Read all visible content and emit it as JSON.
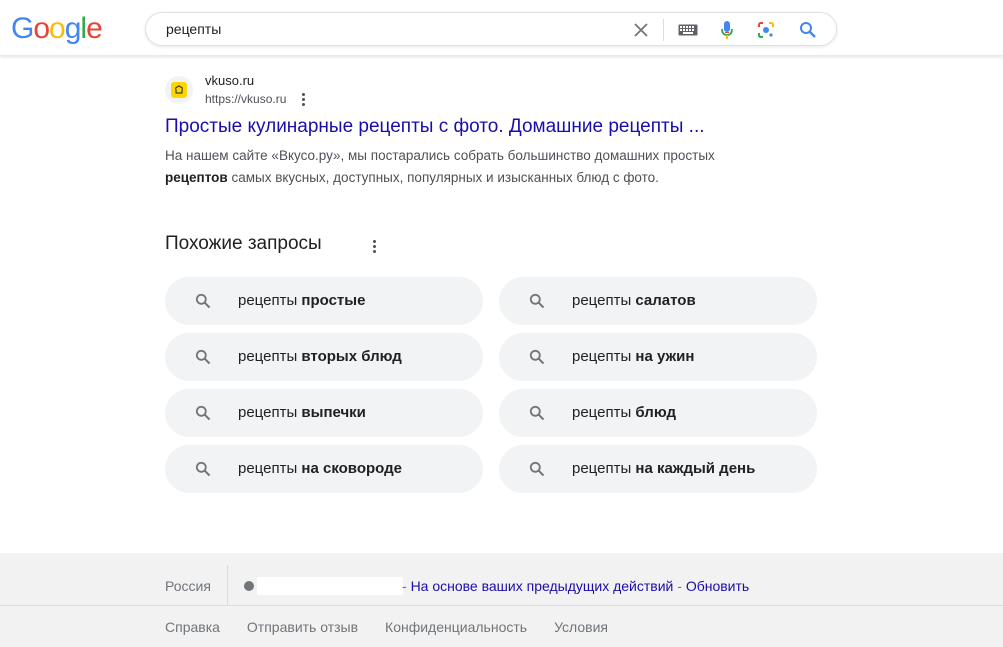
{
  "header": {
    "logo_text": "Google",
    "search_value": "рецепты",
    "icons": [
      "close-icon",
      "keyboard-icon",
      "microphone-icon",
      "lens-icon",
      "search-icon"
    ]
  },
  "result": {
    "site_name": "vkuso.ru",
    "site_url": "https://vkuso.ru",
    "title": "Простые кулинарные рецепты с фото. Домашние рецепты ...",
    "snippet_line1": "На нашем сайте «Вкусо.ру», мы постарались собрать большинство домашних простых",
    "snippet_bold": "рецептов",
    "snippet_line2_rest": " самых вкусных, доступных, популярных и изысканных блюд с фото."
  },
  "related": {
    "heading": "Похожие запросы",
    "items": [
      {
        "prefix": "рецепты ",
        "bold": "простые"
      },
      {
        "prefix": "рецепты ",
        "bold": "салатов"
      },
      {
        "prefix": "рецепты ",
        "bold": "вторых блюд"
      },
      {
        "prefix": "рецепты ",
        "bold": "на ужин"
      },
      {
        "prefix": "рецепты ",
        "bold": "выпечки"
      },
      {
        "prefix": "рецепты ",
        "bold": "блюд"
      },
      {
        "prefix": "рецепты ",
        "bold": "на сковороде"
      },
      {
        "prefix": "рецепты ",
        "bold": "на каждый день"
      }
    ]
  },
  "footer": {
    "country": "Россия",
    "location_basis": "На основе ваших предыдущих действий",
    "update_link": "Обновить",
    "separator": "-",
    "links": [
      "Справка",
      "Отправить отзыв",
      "Конфиденциальность",
      "Условия"
    ]
  },
  "colors": {
    "link": "#1a0dab",
    "chip_bg": "#f1f3f4",
    "footer_bg": "#f2f2f2"
  }
}
